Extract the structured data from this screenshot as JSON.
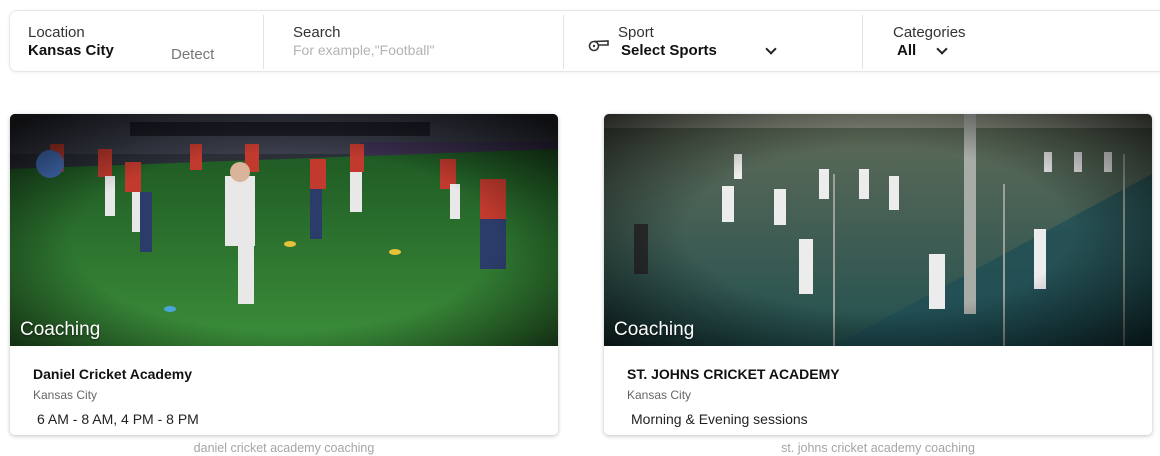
{
  "filters": {
    "location": {
      "label": "Location",
      "value": "Kansas City",
      "detect_label": "Detect"
    },
    "search": {
      "label": "Search",
      "placeholder": "For example,\"Football\""
    },
    "sport": {
      "label": "Sport",
      "value": "Select Sports",
      "icon": "whistle-icon"
    },
    "categories": {
      "label": "Categories",
      "value": "All"
    }
  },
  "cards": [
    {
      "tag": "Coaching",
      "title": "Daniel Cricket Academy",
      "city": "Kansas City",
      "hours": "6 AM - 8 AM, 4 PM - 8 PM",
      "caption": "daniel cricket academy coaching"
    },
    {
      "tag": "Coaching",
      "title": "ST. JOHNS CRICKET ACADEMY",
      "city": "Kansas City",
      "hours": "Morning & Evening sessions",
      "caption": "st. johns cricket academy coaching"
    }
  ],
  "colors": {
    "field_green": "#2f7a32",
    "turf_teal": "#1f4f4f",
    "jersey_red": "#c23a2e"
  }
}
